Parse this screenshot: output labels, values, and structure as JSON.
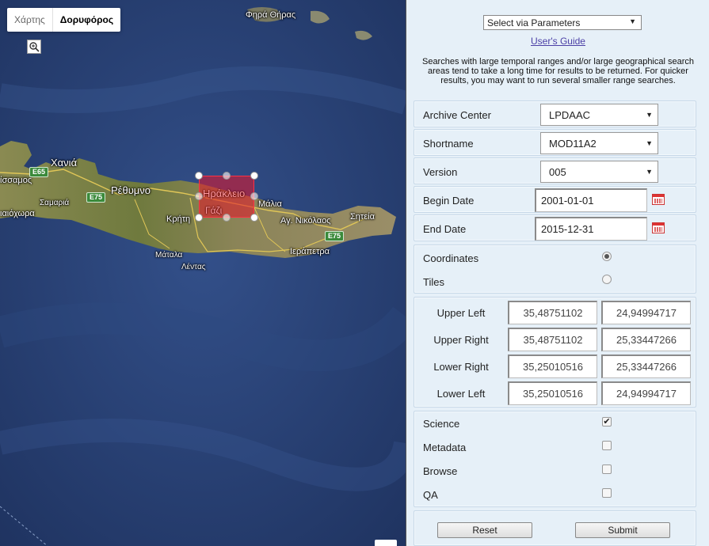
{
  "map": {
    "map_type": {
      "map": "Χάρτης",
      "satellite": "Δορυφόρος"
    },
    "places": {
      "fira": "Φηρά Θήρας",
      "chania": "Χανιά",
      "kissamos": "ίσσαμος",
      "samaria": "Σαμαριά",
      "rethymno": "Ρέθυμνο",
      "chora": "ιαιόχωρα",
      "kriti": "Κρήτη",
      "heraklion": "Ηράκλειο",
      "gazi": "Γάζι",
      "malia": "Μάλια",
      "agnikolaos": "Αγ. Νικόλαος",
      "siteia": "Σητεία",
      "ierapetra": "Ιεράπετρα",
      "matala": "Μάταλα",
      "lentas": "Λέντας"
    },
    "roads": {
      "e65": "E65",
      "e75a": "E75",
      "e75b": "E75"
    }
  },
  "panel": {
    "mode_select": "Select via Parameters",
    "users_guide": "User's Guide",
    "notice": "Searches with large temporal ranges and/or large geographical search areas tend to take a long time for results to be returned. For quicker results, you may want to run several smaller range searches.",
    "archive_center": {
      "label": "Archive Center",
      "value": "LPDAAC"
    },
    "shortname": {
      "label": "Shortname",
      "value": "MOD11A2"
    },
    "version": {
      "label": "Version",
      "value": "005"
    },
    "begin_date": {
      "label": "Begin Date",
      "value": "2001-01-01"
    },
    "end_date": {
      "label": "End Date",
      "value": "2015-12-31"
    },
    "selection": {
      "coordinates": "Coordinates",
      "tiles": "Tiles",
      "selected": "Coordinates"
    },
    "coords": {
      "upper_left": {
        "label": "Upper Left",
        "lat": "35,48751102",
        "lon": "24,94994717"
      },
      "upper_right": {
        "label": "Upper Right",
        "lat": "35,48751102",
        "lon": "25,33447266"
      },
      "lower_right": {
        "label": "Lower Right",
        "lat": "35,25010516",
        "lon": "25,33447266"
      },
      "lower_left": {
        "label": "Lower Left",
        "lat": "35,25010516",
        "lon": "24,94994717"
      }
    },
    "options": {
      "science": {
        "label": "Science",
        "checked": true
      },
      "metadata": {
        "label": "Metadata",
        "checked": false
      },
      "browse": {
        "label": "Browse",
        "checked": false
      },
      "qa": {
        "label": "QA",
        "checked": false
      }
    },
    "check_mark": "✔",
    "reset": "Reset",
    "submit": "Submit"
  }
}
